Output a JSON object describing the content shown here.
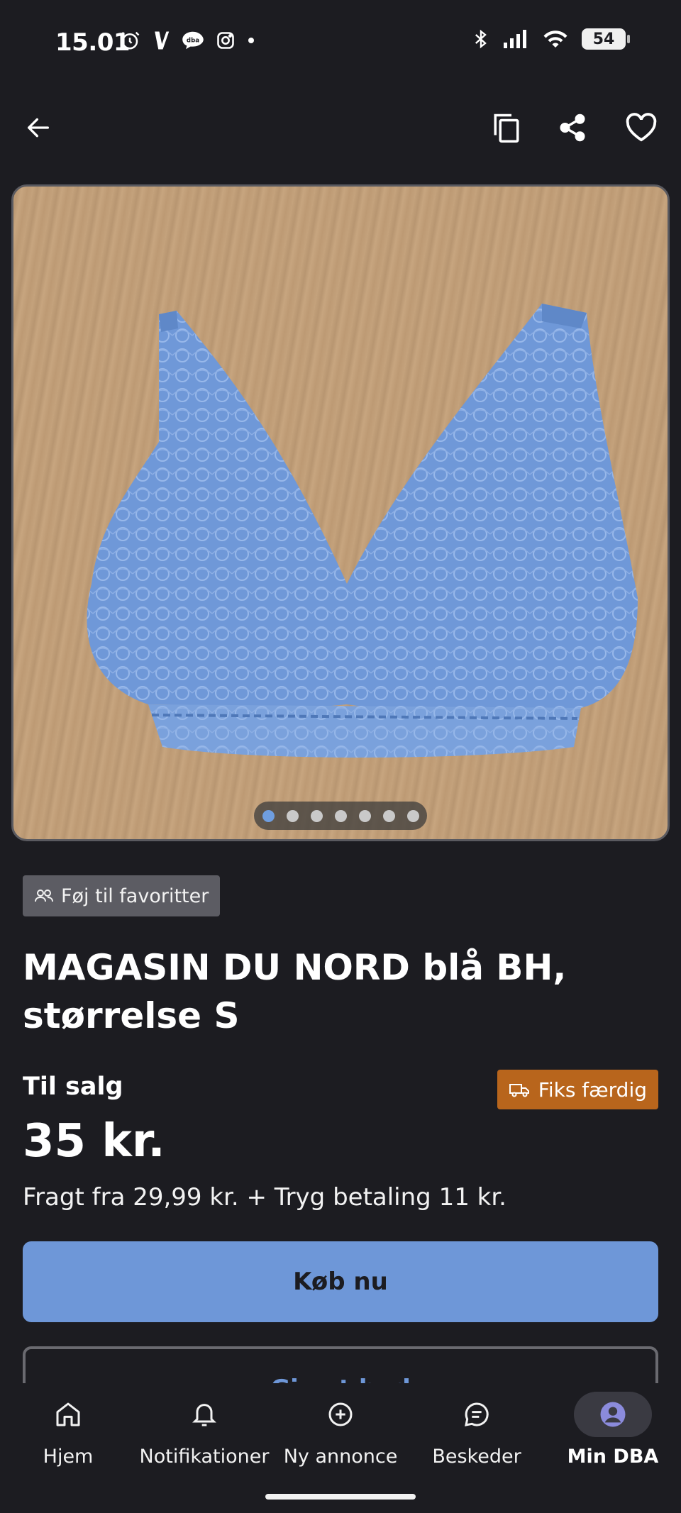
{
  "status_bar": {
    "time": "15.01",
    "battery": "54"
  },
  "toolbar": {
    "back_icon": "arrow-left-icon",
    "copy_icon": "copy-icon",
    "share_icon": "share-icon",
    "favorite_icon": "heart-icon"
  },
  "gallery": {
    "image_count": 7,
    "active_index": 0
  },
  "favorites_badge": {
    "label": "Føj til favoritter"
  },
  "listing": {
    "title_line1": "MAGASIN DU NORD blå BH,",
    "title_line2": "størrelse S",
    "for_sale": "Til salg",
    "shipping_badge": "Fiks færdig",
    "price": "35 kr.",
    "shipping": "Fragt fra 29,99 kr. + Tryg betaling 11 kr."
  },
  "actions": {
    "buy_label": "Køb nu",
    "bid_label": "Giv et bud"
  },
  "bottom_nav": {
    "items": [
      {
        "label": "Hjem",
        "icon": "home-icon"
      },
      {
        "label": "Notifikationer",
        "icon": "bell-icon"
      },
      {
        "label": "Ny annonce",
        "icon": "plus-circle-icon"
      },
      {
        "label": "Beskeder",
        "icon": "chat-icon"
      },
      {
        "label": "Min DBA",
        "icon": "profile-icon",
        "active": true
      }
    ]
  },
  "colors": {
    "background": "#1c1c21",
    "accent_blue": "#6e97d8",
    "badge_orange": "#b8651c"
  }
}
